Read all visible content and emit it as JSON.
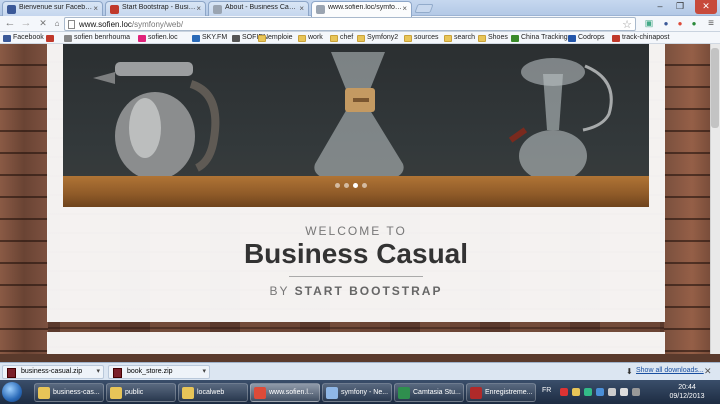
{
  "tabs": [
    {
      "label": "Bienvenue sur Facebook",
      "fav_color": "#3b5998",
      "active": false
    },
    {
      "label": "Start Bootstrap - Busines",
      "fav_color": "#c0392b",
      "active": false
    },
    {
      "label": "About - Business Casual",
      "fav_color": "#9aa4b1",
      "active": false
    },
    {
      "label": "www.sofien.loc/symfony/",
      "fav_color": "#9aa4b1",
      "active": true
    }
  ],
  "address": {
    "host": "www.sofien.loc",
    "path": "/symfony/web/"
  },
  "bookmarks": [
    {
      "label": "Facebook",
      "color": "#3b5998"
    },
    {
      "label": "",
      "color": "#c0392b"
    },
    {
      "label": "sofien benrhouma",
      "color": "#888"
    },
    {
      "label": "sofien.loc",
      "color": "#e0227a"
    },
    {
      "label": "SKY.FM",
      "color": "#2a6ab8"
    },
    {
      "label": "SOFIEN",
      "color": "#555"
    },
    {
      "label": "emploie",
      "folder": true
    },
    {
      "label": "work",
      "folder": true
    },
    {
      "label": "chef",
      "folder": true
    },
    {
      "label": "Symfony2",
      "folder": true
    },
    {
      "label": "sources",
      "folder": true
    },
    {
      "label": "search",
      "folder": true
    },
    {
      "label": "Shoes",
      "folder": true
    },
    {
      "label": "China Tracking",
      "color": "#3a8a2a"
    },
    {
      "label": "Codrops",
      "color": "#2255aa"
    },
    {
      "label": "track-chinapost",
      "color": "#c0392b"
    }
  ],
  "hero": {
    "welcome": "WELCOME TO",
    "title": "Business Casual",
    "by": "BY",
    "author": "START BOOTSTRAP"
  },
  "downloads": [
    {
      "name": "business-casual.zip"
    },
    {
      "name": "book_store.zip"
    }
  ],
  "show_all": "Show all downloads...",
  "taskbar": [
    {
      "label": "business-cas...",
      "color": "#e8c558"
    },
    {
      "label": "public",
      "color": "#e8c558"
    },
    {
      "label": "localweb",
      "color": "#e8c558"
    },
    {
      "label": "www.sofien.l...",
      "color": "#dd4b39",
      "active": true
    },
    {
      "label": "symfony - Ne...",
      "color": "#8fb7e6"
    },
    {
      "label": "Camtasia Stu...",
      "color": "#2f8f4e"
    },
    {
      "label": "Enregistreme...",
      "color": "#b02a2a"
    }
  ],
  "lang": "FR",
  "clock": {
    "time": "20:44",
    "date": "09/12/2013"
  }
}
